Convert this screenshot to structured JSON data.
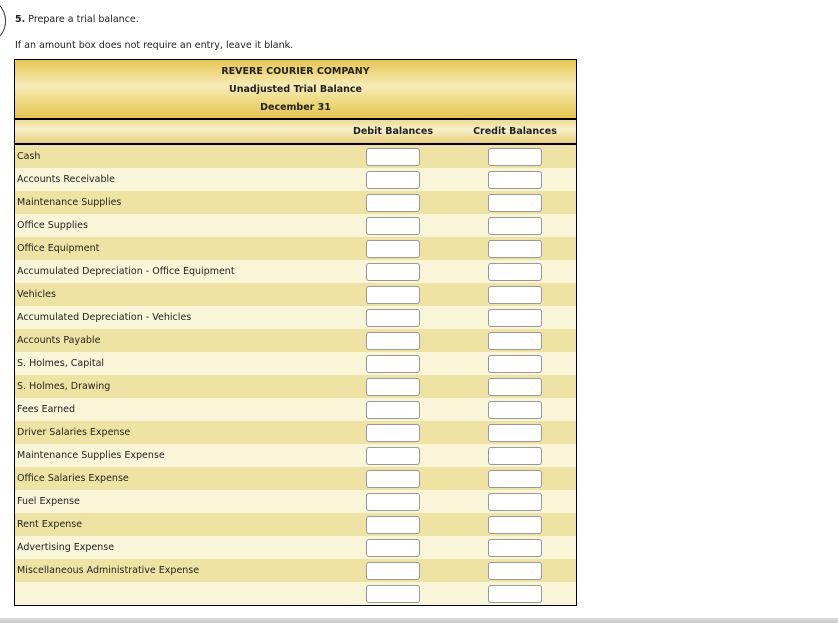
{
  "question": {
    "number": "5.",
    "text": "Prepare a trial balance.",
    "note": "If an amount box does not require an entry, leave it blank."
  },
  "trial_balance": {
    "company": "REVERE COURIER COMPANY",
    "title": "Unadjusted Trial Balance",
    "date": "December 31",
    "columns": {
      "debit": "Debit Balances",
      "credit": "Credit Balances"
    },
    "accounts": [
      {
        "name": "Cash",
        "debit": "",
        "credit": ""
      },
      {
        "name": "Accounts Receivable",
        "debit": "",
        "credit": ""
      },
      {
        "name": "Maintenance Supplies",
        "debit": "",
        "credit": ""
      },
      {
        "name": "Office Supplies",
        "debit": "",
        "credit": ""
      },
      {
        "name": "Office Equipment",
        "debit": "",
        "credit": ""
      },
      {
        "name": "Accumulated Depreciation - Office Equipment",
        "debit": "",
        "credit": ""
      },
      {
        "name": "Vehicles",
        "debit": "",
        "credit": ""
      },
      {
        "name": "Accumulated Depreciation - Vehicles",
        "debit": "",
        "credit": ""
      },
      {
        "name": "Accounts Payable",
        "debit": "",
        "credit": ""
      },
      {
        "name": "S. Holmes, Capital",
        "debit": "",
        "credit": ""
      },
      {
        "name": "S. Holmes, Drawing",
        "debit": "",
        "credit": ""
      },
      {
        "name": "Fees Earned",
        "debit": "",
        "credit": ""
      },
      {
        "name": "Driver Salaries Expense",
        "debit": "",
        "credit": ""
      },
      {
        "name": "Maintenance Supplies Expense",
        "debit": "",
        "credit": ""
      },
      {
        "name": "Office Salaries Expense",
        "debit": "",
        "credit": ""
      },
      {
        "name": "Fuel Expense",
        "debit": "",
        "credit": ""
      },
      {
        "name": "Rent Expense",
        "debit": "",
        "credit": ""
      },
      {
        "name": "Advertising Expense",
        "debit": "",
        "credit": ""
      },
      {
        "name": "Miscellaneous Administrative Expense",
        "debit": "",
        "credit": ""
      },
      {
        "name": "",
        "debit": "",
        "credit": ""
      }
    ]
  }
}
